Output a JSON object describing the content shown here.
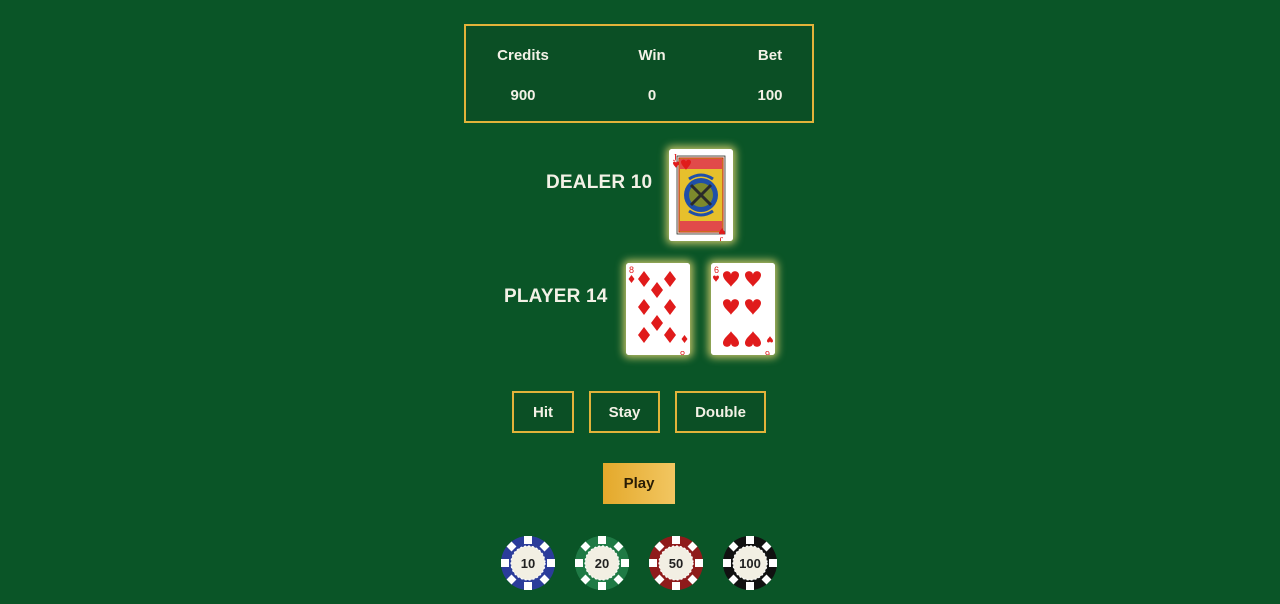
{
  "scoreboard": {
    "credits_label": "Credits",
    "credits_value": "900",
    "win_label": "Win",
    "win_value": "0",
    "bet_label": "Bet",
    "bet_value": "100"
  },
  "dealer": {
    "label": "DEALER 10",
    "cards": [
      {
        "rank": "J",
        "suit": "hearts"
      }
    ]
  },
  "player": {
    "label": "PLAYER 14",
    "cards": [
      {
        "rank": "8",
        "suit": "diamonds"
      },
      {
        "rank": "6",
        "suit": "hearts"
      }
    ]
  },
  "actions": {
    "hit": "Hit",
    "stay": "Stay",
    "double": "Double"
  },
  "play_label": "Play",
  "chips": [
    {
      "value": "10",
      "color": "#2b3c9a"
    },
    {
      "value": "20",
      "color": "#1f7a45"
    },
    {
      "value": "50",
      "color": "#8f1b1b"
    },
    {
      "value": "100",
      "color": "#111111"
    }
  ],
  "colors": {
    "felt": "#0a5527",
    "gold": "#e2b33a",
    "card_red": "#e01b1b"
  }
}
